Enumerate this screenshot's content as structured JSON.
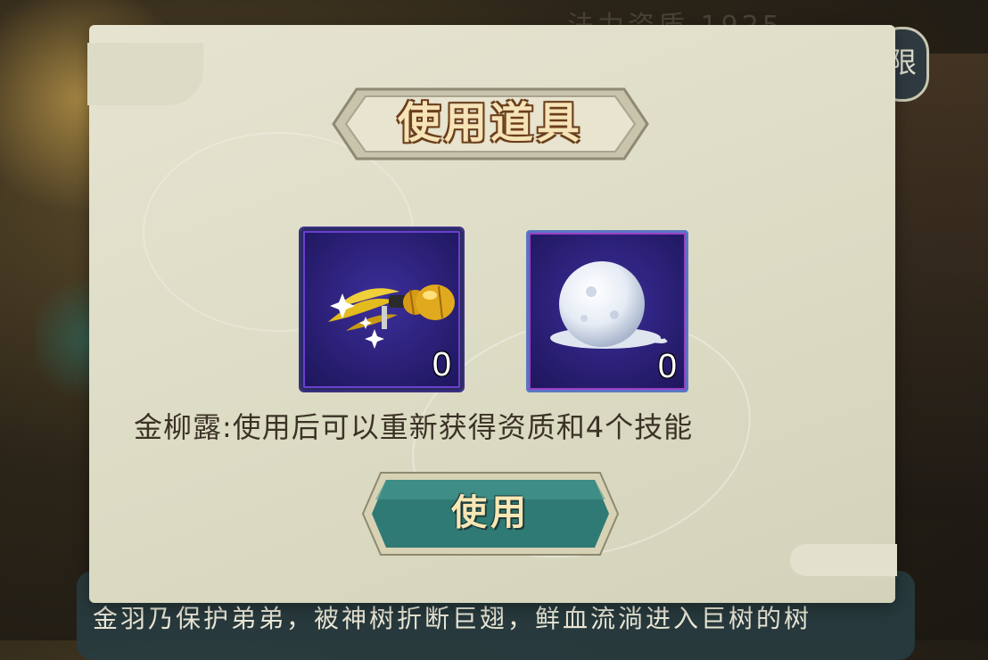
{
  "background": {
    "top_text": "法力资质 1925",
    "top_button_glyph": "限",
    "story_text": "金羽乃保护弟弟，被神树折断巨翅，鲜血流淌进入巨树的树"
  },
  "dialog": {
    "title": "使用道具",
    "items": [
      {
        "icon": "golden-willow-dew-icon",
        "count": "0",
        "selected": true
      },
      {
        "icon": "snowball-icon",
        "count": "0",
        "selected": false
      }
    ],
    "description": "金柳露:使用后可以重新获得资质和4个技能",
    "use_button_label": "使用"
  },
  "colors": {
    "panel": "#dcdbc4",
    "slot": "#2b2077",
    "button": "#2f7a74",
    "title_text": "#f6e3b6"
  }
}
